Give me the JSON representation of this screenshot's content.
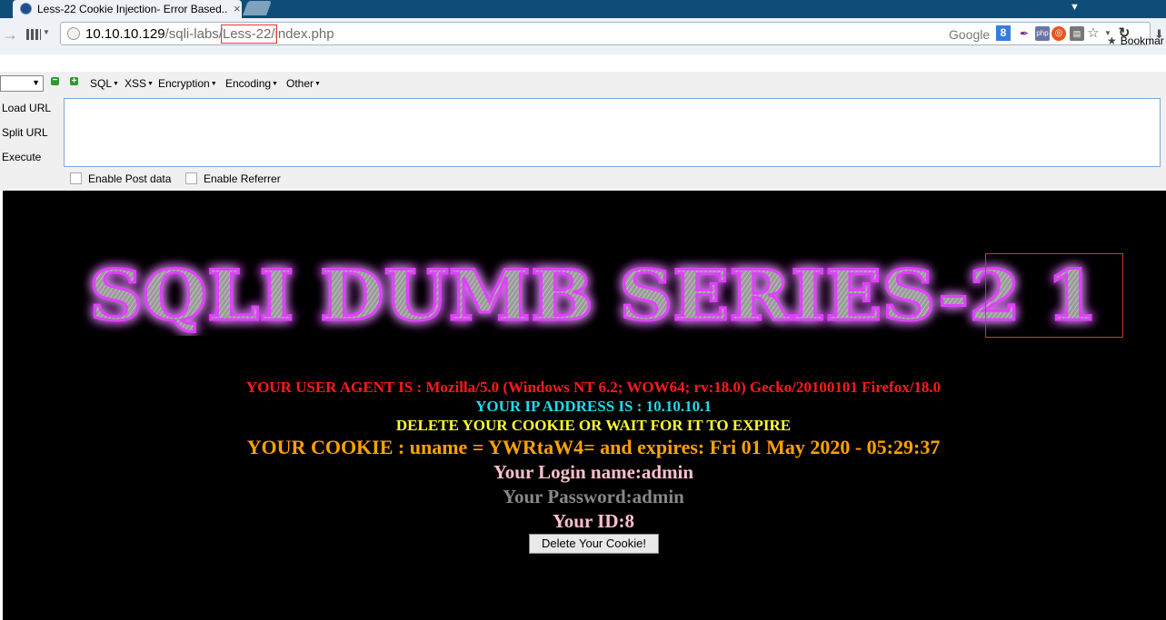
{
  "browser": {
    "tab_title": "Less-22 Cookie Injection- Error Based...",
    "tab_close": "×",
    "url_host": "10.10.10.129",
    "url_path_prefix": "/sqli-labs/",
    "url_path_highlight": "Less-22/",
    "url_path_rest": "index.php",
    "search_engine": "Google",
    "bookmarks_label": "Bookmar",
    "icons": [
      "back-arrow-icon",
      "apps-icon",
      "globe-icon",
      "google-icon",
      "feather-icon",
      "php-icon",
      "ubuntu-icon",
      "database-icon",
      "star-icon",
      "reload-icon"
    ]
  },
  "hackbar": {
    "menus": [
      "SQL",
      "XSS",
      "Encryption",
      "Encoding",
      "Other"
    ],
    "actions": {
      "load": "Load URL",
      "split": "Split URL",
      "execute": "Execute"
    },
    "checkboxes": {
      "post": "Enable Post data",
      "referrer": "Enable Referrer"
    },
    "textarea_value": ""
  },
  "page": {
    "banner_text": "SQLI DUMB SERIES-2 1",
    "user_agent": "YOUR USER AGENT IS : Mozilla/5.0 (Windows NT 6.2; WOW64; rv:18.0) Gecko/20100101 Firefox/18.0",
    "ip_address": "YOUR IP ADDRESS IS : 10.10.10.1",
    "delete_message": "DELETE YOUR COOKIE OR WAIT FOR IT TO EXPIRE",
    "cookie": "YOUR COOKIE : uname = YWRtaW4= and expires: Fri 01 May 2020 - 05:29:37",
    "login_name": "Your Login name:admin",
    "password": "Your Password:admin",
    "user_id": "Your ID:8",
    "delete_button": "Delete Your Cookie!"
  },
  "colors": {
    "tabstrip": "#0e4d78",
    "page_bg": "#000000",
    "user_agent": "#ff1a1a",
    "ip": "#22d9ee",
    "delete_msg": "#ffff33",
    "cookie": "#ffa200",
    "login": "#ffc0cb",
    "password": "#888888",
    "banner_glow": "#d020e0"
  }
}
